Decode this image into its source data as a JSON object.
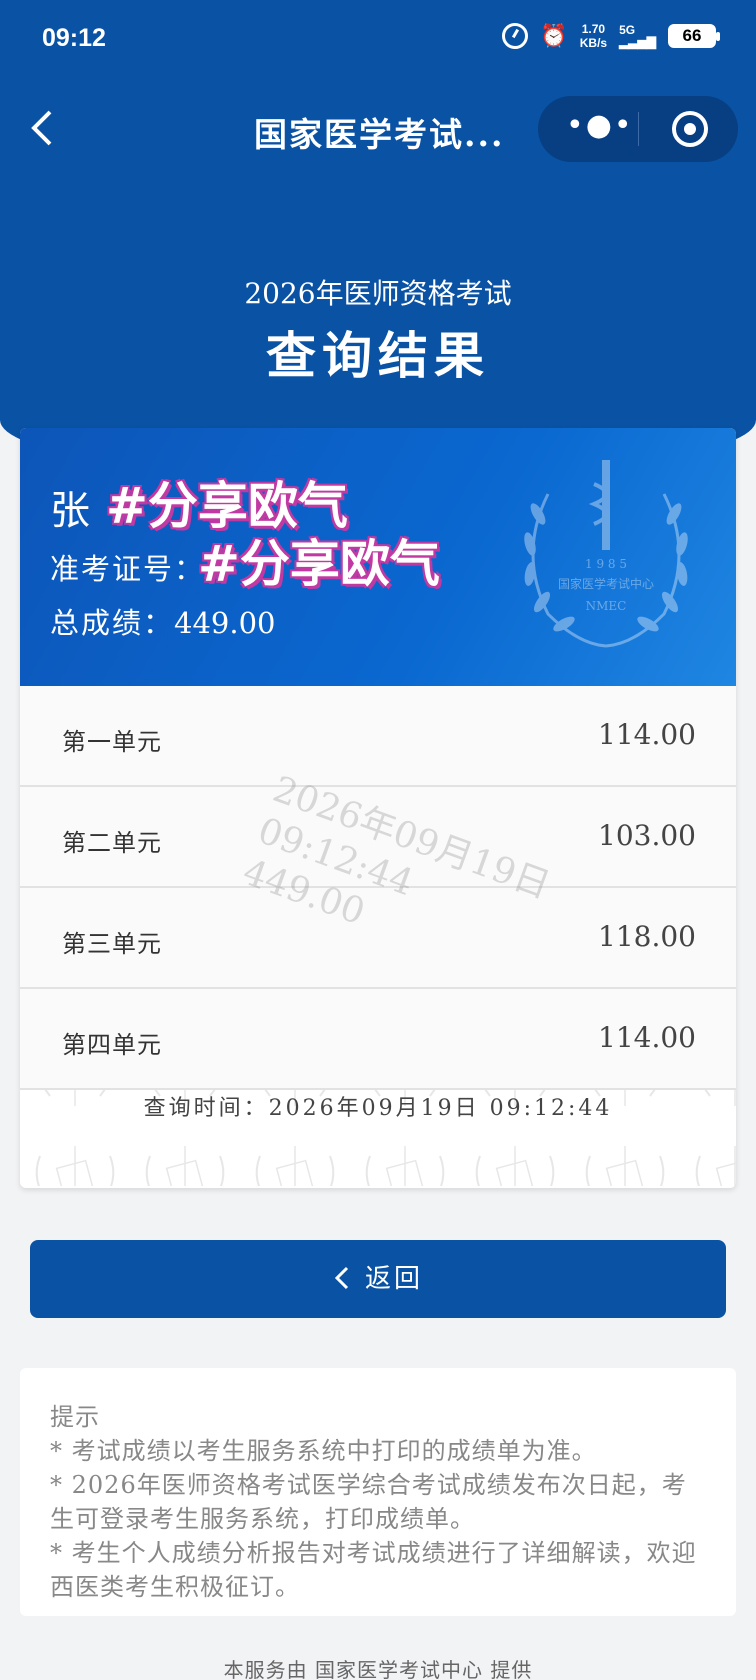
{
  "status_bar": {
    "time": "09:12",
    "network_speed": "1.70",
    "network_unit": "KB/s",
    "signal_label": "5G",
    "battery": "66"
  },
  "nav": {
    "title": "国家医学考试...",
    "back_icon": "chevron-left-icon",
    "more_icon": "more-dots-icon",
    "target_icon": "target-icon"
  },
  "hero": {
    "subtitle": "2026年医师资格考试",
    "title": "查询结果"
  },
  "candidate": {
    "name": "张",
    "exam_id_label": "准考证号：",
    "total_label": "总成绩：",
    "total_score": "449.00",
    "overlay_text_1": "#分享欧气",
    "overlay_text_2": "#分享欧气",
    "seal_year": "1 9 8 5",
    "seal_org": "国家医学考试中心",
    "seal_abbr": "NMEC"
  },
  "units": [
    {
      "label": "第一单元",
      "score": "114.00"
    },
    {
      "label": "第二单元",
      "score": "103.00"
    },
    {
      "label": "第三单元",
      "score": "118.00"
    },
    {
      "label": "第四单元",
      "score": "114.00"
    }
  ],
  "watermark": {
    "date": "2026年09月19日",
    "time": "09:12:44",
    "score": "449.00"
  },
  "query_time": "查询时间：2026年09月19日 09:12:44",
  "return_button": {
    "icon": "chevron-left-icon",
    "label": "返回"
  },
  "tips": {
    "title": "提示",
    "items": [
      "考试成绩以考生服务系统中打印的成绩单为准。",
      "2026年医师资格考试医学综合考试成绩发布次日起，考生可登录考生服务系统，打印成绩单。",
      "考生个人成绩分析报告对考试成绩进行了详细解读，欢迎西医类考生积极征订。"
    ]
  },
  "footer": "本服务由 国家医学考试中心 提供",
  "colors": {
    "primary": "#0a52a3",
    "card_gradient_start": "#0d55b8",
    "card_gradient_end": "#1f86e2",
    "overlay_outline": "#c13aa3"
  }
}
